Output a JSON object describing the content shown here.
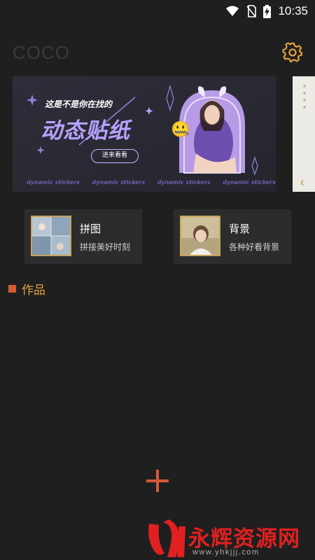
{
  "status_bar": {
    "time": "10:35",
    "icons": [
      "wifi-icon",
      "no-sim-icon",
      "battery-charging-icon"
    ]
  },
  "app": {
    "title": "COCO",
    "accent_color": "#d45a34",
    "gold_color": "#c8a45a"
  },
  "banner": {
    "line1": "这是不是你在找的",
    "headline": "动态贴纸",
    "button_label": "进来看看",
    "footer_text": "dynamic stickers",
    "emoji": "🤐"
  },
  "tiles": [
    {
      "title": "拼图",
      "subtitle": "拼接美好时刻"
    },
    {
      "title": "背景",
      "subtitle": "各种好看背景"
    }
  ],
  "section": {
    "title": "作品"
  },
  "watermark": {
    "brand": "永辉资源网",
    "url": "www.yhkjjj.com"
  },
  "icons": {
    "settings": "gear-icon",
    "add": "plus-icon"
  }
}
